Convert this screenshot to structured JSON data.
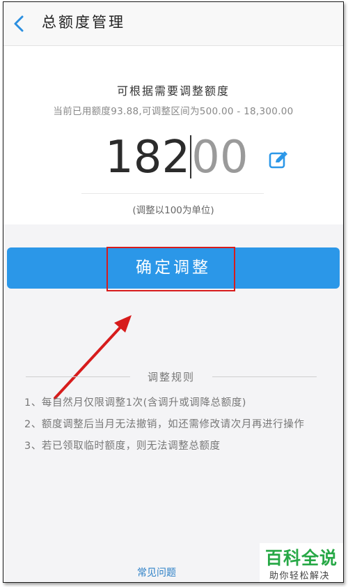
{
  "header": {
    "title": "总额度管理"
  },
  "adjust": {
    "subtitle": "可根据需要调整额度",
    "range_text": "当前已用额度93.88,可调整区间为500.00 - 18,300.00",
    "amount_typed": "182",
    "amount_placeholder": "00",
    "unit_note": "(调整以100为单位)",
    "confirm_label": "确定调整"
  },
  "rules": {
    "title": "调整规则",
    "items": [
      "1、每自然月仅限调整1次(含调升或调降总额度)",
      "2、额度调整后当月无法撤销，如还需修改请次月再进行操作",
      "3、若已领取临时额度，则无法调整总额度"
    ]
  },
  "footer": {
    "faq_label": "常见问题"
  },
  "watermark": {
    "main": "百科全说",
    "sub": "助你轻松解决"
  },
  "colors": {
    "accent": "#2b97e8",
    "annotation": "#d71c1c",
    "brand_watermark": "#27a846"
  }
}
